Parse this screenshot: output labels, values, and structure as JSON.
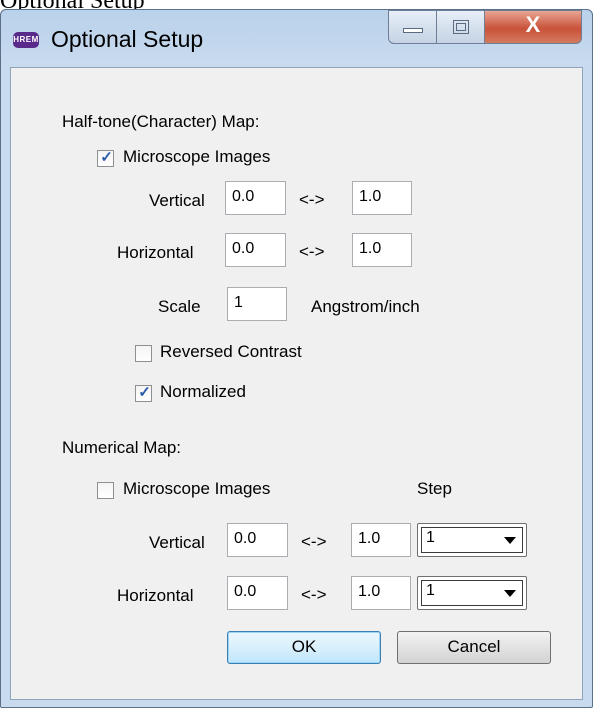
{
  "caption_strip": "Optional Setup",
  "window": {
    "icon_text": "HREM",
    "title": "Optional Setup",
    "minimize_glyph": "",
    "close_glyph": "X"
  },
  "halftone": {
    "section_label": "Half-tone(Character) Map:",
    "microscope_label": "Microscope Images",
    "microscope_checked": true,
    "vertical_label": "Vertical",
    "vertical_from": "0.0",
    "vertical_to": "1.0",
    "horizontal_label": "Horizontal",
    "horizontal_from": "0.0",
    "horizontal_to": "1.0",
    "range_arrow": "<->",
    "scale_label": "Scale",
    "scale_value": "1",
    "scale_unit": "Angstrom/inch",
    "reversed_label": "Reversed Contrast",
    "reversed_checked": false,
    "normalized_label": "Normalized",
    "normalized_checked": true
  },
  "numerical": {
    "section_label": "Numerical Map:",
    "microscope_label": "Microscope Images",
    "microscope_checked": false,
    "step_label": "Step",
    "vertical_label": "Vertical",
    "vertical_from": "0.0",
    "vertical_to": "1.0",
    "vertical_step": "1",
    "horizontal_label": "Horizontal",
    "horizontal_from": "0.0",
    "horizontal_to": "1.0",
    "horizontal_step": "1",
    "range_arrow": "<->"
  },
  "buttons": {
    "ok": "OK",
    "cancel": "Cancel"
  },
  "check_glyph": "✓"
}
